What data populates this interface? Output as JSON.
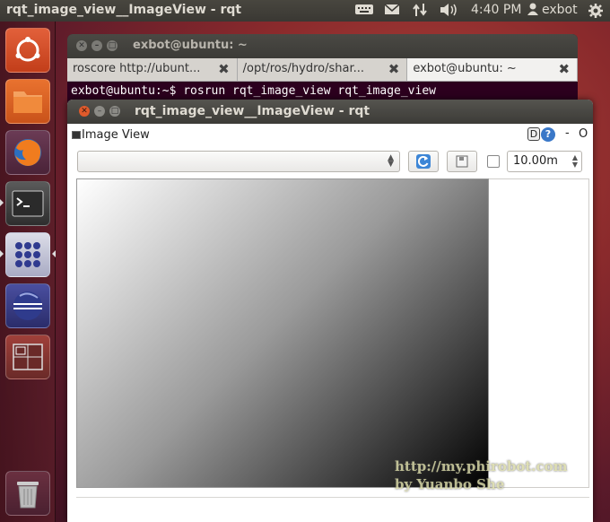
{
  "top_panel": {
    "app_title": "rqt_image_view__ImageView - rqt",
    "time": "4:40 PM",
    "user": "exbot"
  },
  "launcher": {
    "items": [
      "Dash home",
      "Files",
      "Firefox",
      "Terminal",
      "Apps",
      "Eclipse",
      "Workspace switcher",
      "Trash"
    ]
  },
  "terminal": {
    "title": "exbot@ubuntu: ~",
    "tabs": [
      {
        "label": "roscore http://ubunt..."
      },
      {
        "label": "/opt/ros/hydro/shar..."
      },
      {
        "label": "exbot@ubuntu: ~"
      }
    ],
    "line": "exbot@ubuntu:~$ rosrun rqt_image_view rqt_image_view"
  },
  "rqt": {
    "title": "rqt_image_view__ImageView - rqt",
    "plugin_title": "Image View",
    "help_d": "D",
    "help_q": "?",
    "dash": "-",
    "close_o": "O",
    "topic_value": "",
    "zoom_value": "10.00m"
  },
  "watermark": {
    "line1": "http://my.phirobot.com",
    "line2": "by Yuanbo She"
  },
  "colors": {
    "panel": "#3c3b37",
    "terminal_bg": "#2c001e",
    "close_button": "#e05a2b"
  }
}
